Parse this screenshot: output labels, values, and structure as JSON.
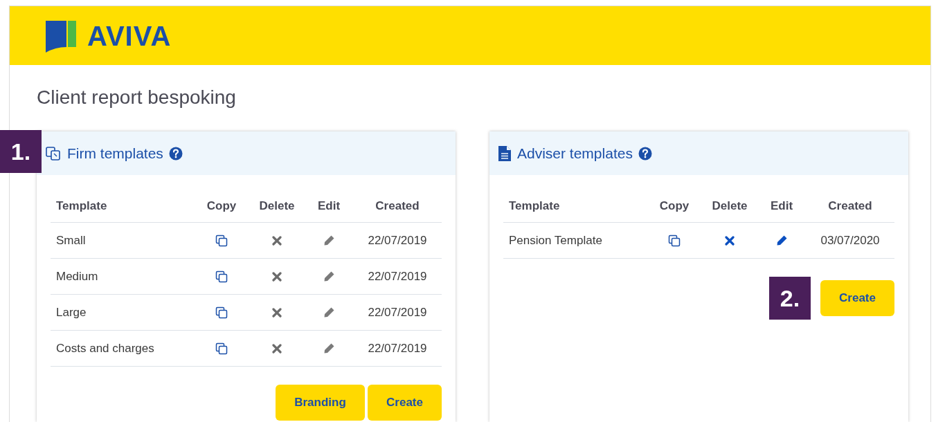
{
  "header": {
    "logo_text": "AVIVA"
  },
  "page_title": "Client report bespoking",
  "panels": [
    {
      "kind": "firm",
      "title": "Firm templates",
      "callout": "1.",
      "columns": [
        "Template",
        "Copy",
        "Delete",
        "Edit",
        "Created"
      ],
      "rows": [
        {
          "name": "Small",
          "created": "22/07/2019",
          "editable": false
        },
        {
          "name": "Medium",
          "created": "22/07/2019",
          "editable": false
        },
        {
          "name": "Large",
          "created": "22/07/2019",
          "editable": false
        },
        {
          "name": "Costs and charges",
          "created": "22/07/2019",
          "editable": false
        }
      ],
      "buttons": [
        "Branding",
        "Create"
      ]
    },
    {
      "kind": "adviser",
      "title": "Adviser templates",
      "callout": "2.",
      "columns": [
        "Template",
        "Copy",
        "Delete",
        "Edit",
        "Created"
      ],
      "rows": [
        {
          "name": "Pension Template",
          "created": "03/07/2020",
          "editable": true
        }
      ],
      "buttons": [
        "Create"
      ]
    }
  ]
}
